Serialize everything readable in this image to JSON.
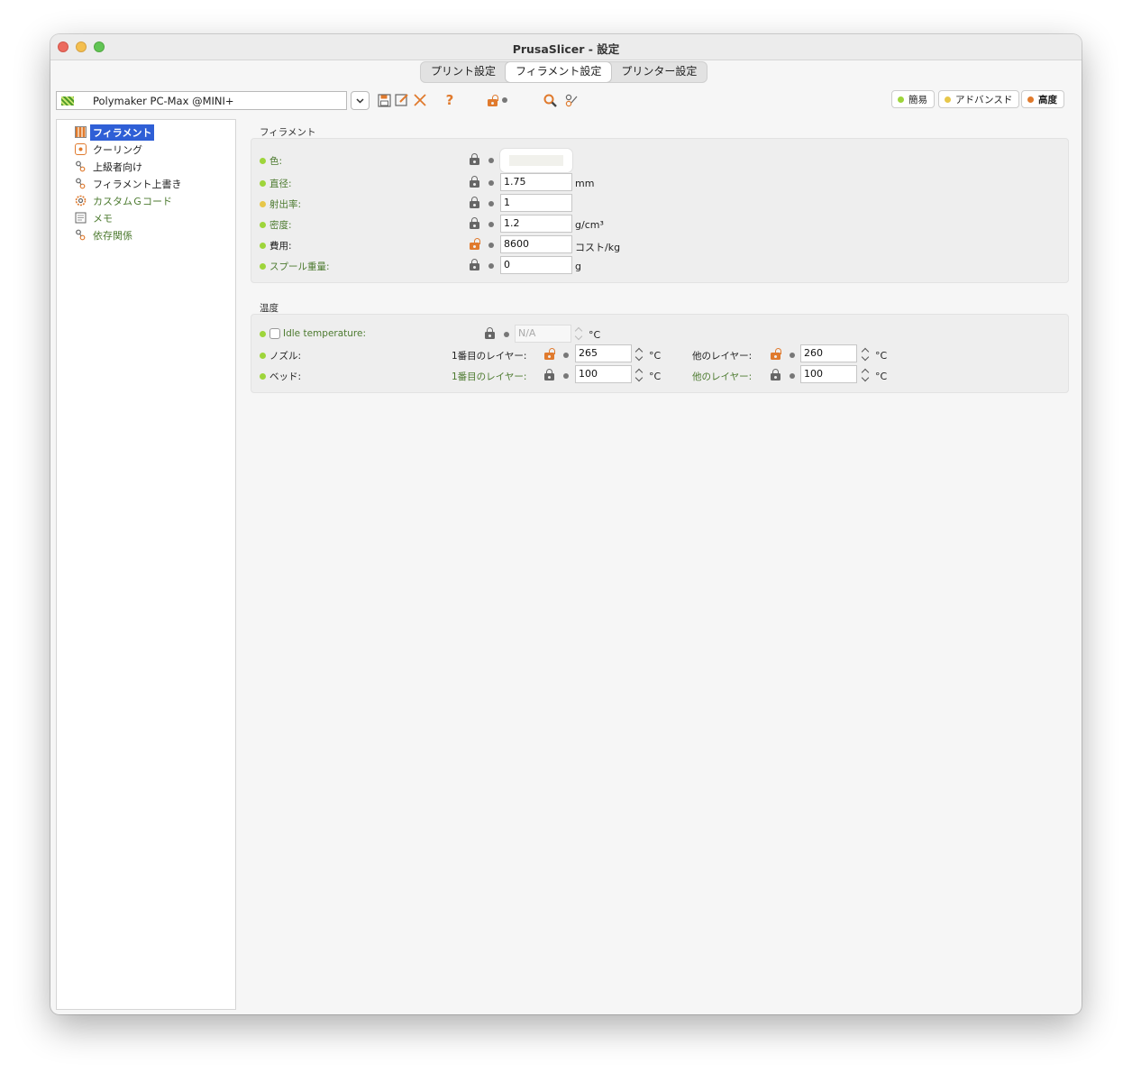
{
  "window": {
    "title": "PrusaSlicer - 設定"
  },
  "tabs": [
    {
      "label": "プリント設定",
      "active": false
    },
    {
      "label": "フィラメント設定",
      "active": true
    },
    {
      "label": "プリンター設定",
      "active": false
    }
  ],
  "preset": {
    "value": "Polymaker PC-Max @MINI+"
  },
  "toolbar": {
    "help_glyph": "?",
    "icons": [
      "save-icon",
      "rename-icon",
      "delete-icon",
      "help-icon",
      "lock-icon",
      "search-icon",
      "compare-icon"
    ]
  },
  "modes": [
    {
      "label": "簡易",
      "color": "#9ed53b"
    },
    {
      "label": "アドバンスド",
      "color": "#e7c74a"
    },
    {
      "label": "高度",
      "color": "#e07a2d",
      "active": true
    }
  ],
  "sidebar": {
    "items": [
      {
        "label": "フィラメント",
        "icon": "spool-icon",
        "selected": true,
        "color": "#222222"
      },
      {
        "label": "クーリング",
        "icon": "fan-icon",
        "color": "#222222"
      },
      {
        "label": "上級者向け",
        "icon": "wrench-icon",
        "color": "#222222"
      },
      {
        "label": "フィラメント上書き",
        "icon": "wrench-icon",
        "color": "#222222"
      },
      {
        "label": "カスタムＧコード",
        "icon": "gear-icon",
        "color": "#4c7a2f"
      },
      {
        "label": "メモ",
        "icon": "note-icon",
        "color": "#4c7a2f"
      },
      {
        "label": "依存関係",
        "icon": "wrench-icon",
        "color": "#4c7a2f"
      }
    ]
  },
  "filament_section": {
    "title": "フィラメント",
    "rows": [
      {
        "label": "色:",
        "mode_color": "#9ed53b",
        "lock": "locked",
        "value": ""
      },
      {
        "label": "直径:",
        "mode_color": "#9ed53b",
        "lock": "locked",
        "value": "1.75",
        "unit": "mm"
      },
      {
        "label": "射出率:",
        "mode_color": "#e7c74a",
        "lock": "locked",
        "value": "1"
      },
      {
        "label": "密度:",
        "mode_color": "#9ed53b",
        "lock": "locked",
        "value": "1.2",
        "unit": "g/cm³"
      },
      {
        "label": "費用:",
        "mode_color": "#9ed53b",
        "lock": "open",
        "value": "8600",
        "unit": "コスト/kg"
      },
      {
        "label": "スプール重量:",
        "mode_color": "#9ed53b",
        "lock": "locked",
        "value": "0",
        "unit": "g"
      }
    ]
  },
  "temperature_section": {
    "title": "温度",
    "idle": {
      "label": "Idle temperature:",
      "value": "N/A",
      "unit": "°C",
      "checked": false
    },
    "nozzle": {
      "label": "ノズル:",
      "first_label": "1番目のレイヤー:",
      "first_value": "265",
      "first_lock": "open",
      "other_label": "他のレイヤー:",
      "other_value": "260",
      "other_lock": "open",
      "unit": "°C"
    },
    "bed": {
      "label": "ベッド:",
      "first_label": "1番目のレイヤー:",
      "first_value": "100",
      "first_lock": "locked",
      "other_label": "他のレイヤー:",
      "other_value": "100",
      "other_lock": "locked",
      "unit": "°C"
    }
  }
}
